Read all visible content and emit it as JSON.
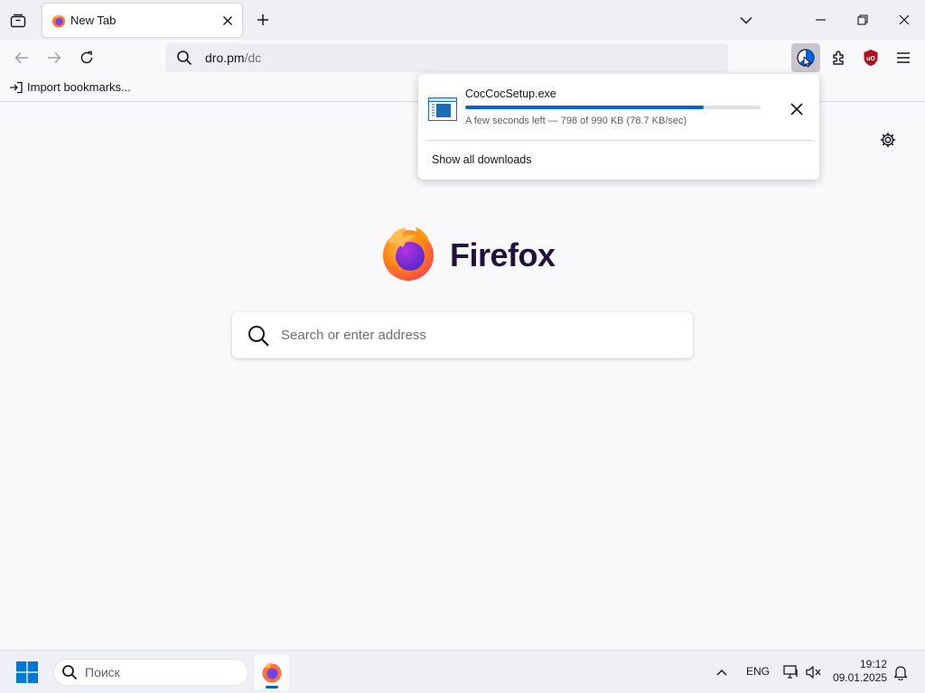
{
  "window": {
    "tab_list_icon": "tab-list-icon",
    "minimize_icon": "minimize-icon",
    "restore_icon": "restore-icon",
    "close_icon": "close-icon"
  },
  "tabs": [
    {
      "title": "New Tab",
      "favicon": "firefox-icon",
      "active": true
    }
  ],
  "navbar": {
    "url_domain": "dro.pm",
    "url_path": "/dc",
    "search_icon": "search-icon"
  },
  "bookmarks": {
    "import_label": "Import bookmarks..."
  },
  "newtab": {
    "brand": "Firefox",
    "search_placeholder": "Search or enter address"
  },
  "download_panel": {
    "filename": "CocCocSetup.exe",
    "status": "A few seconds left — 798 of 990 KB (78.7 KB/sec)",
    "progress_fraction": 0.806,
    "show_all_label": "Show all downloads"
  },
  "taskbar": {
    "search_label": "Поиск",
    "language": "ENG",
    "time": "19:12",
    "date": "09.01.2025"
  },
  "colors": {
    "accent": "#0060df",
    "tabstrip": "#f0f0f4",
    "taskbar": "#eef0f5",
    "ublock": "#b50d1e"
  }
}
